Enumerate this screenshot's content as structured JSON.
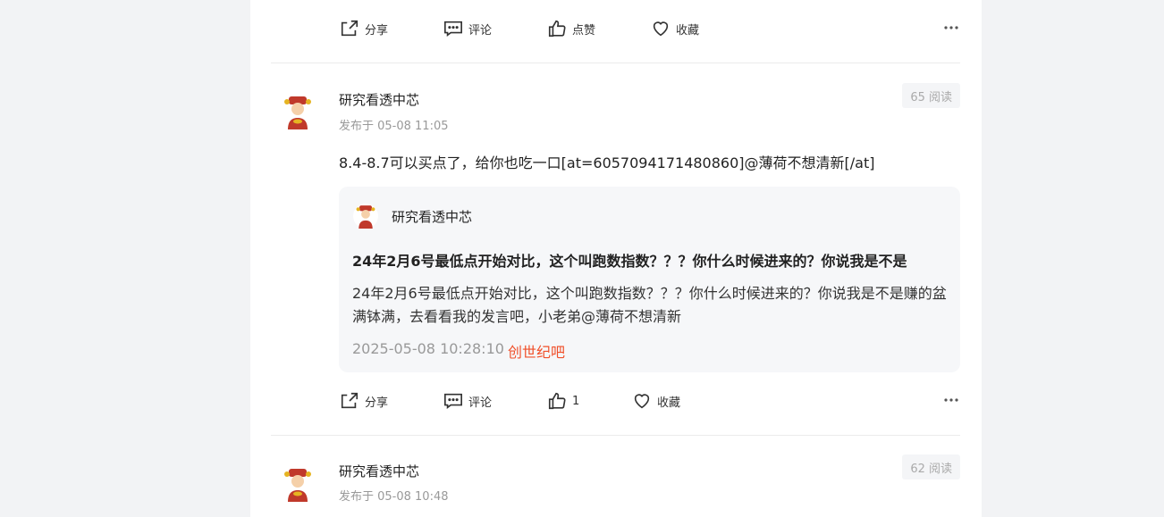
{
  "top_actions": {
    "share": "分享",
    "comment": "评论",
    "like": "点赞",
    "favorite": "收藏"
  },
  "post1": {
    "author": "研究看透中芯",
    "time": "发布于 05-08 11:05",
    "reads": "65 阅读",
    "content": "8.4-8.7可以买点了，给你也吃一口[at=6057094171480860]@薄荷不想清新[/at]",
    "quote": {
      "author": "研究看透中芯",
      "title": "24年2月6号最低点开始对比，这个叫跑数指数？？？你什么时候进来的？你说我是不是",
      "body": "24年2月6号最低点开始对比，这个叫跑数指数？？？你什么时候进来的？你说我是不是赚的盆满钵满，去看看我的发言吧，小老弟@薄荷不想清新",
      "date": "2025-05-08 10:28:10",
      "source": "创世纪吧"
    },
    "actions": {
      "share": "分享",
      "comment": "评论",
      "like": "1",
      "favorite": "收藏"
    }
  },
  "post2": {
    "author": "研究看透中芯",
    "time": "发布于 05-08 10:48",
    "reads": "62 阅读"
  }
}
